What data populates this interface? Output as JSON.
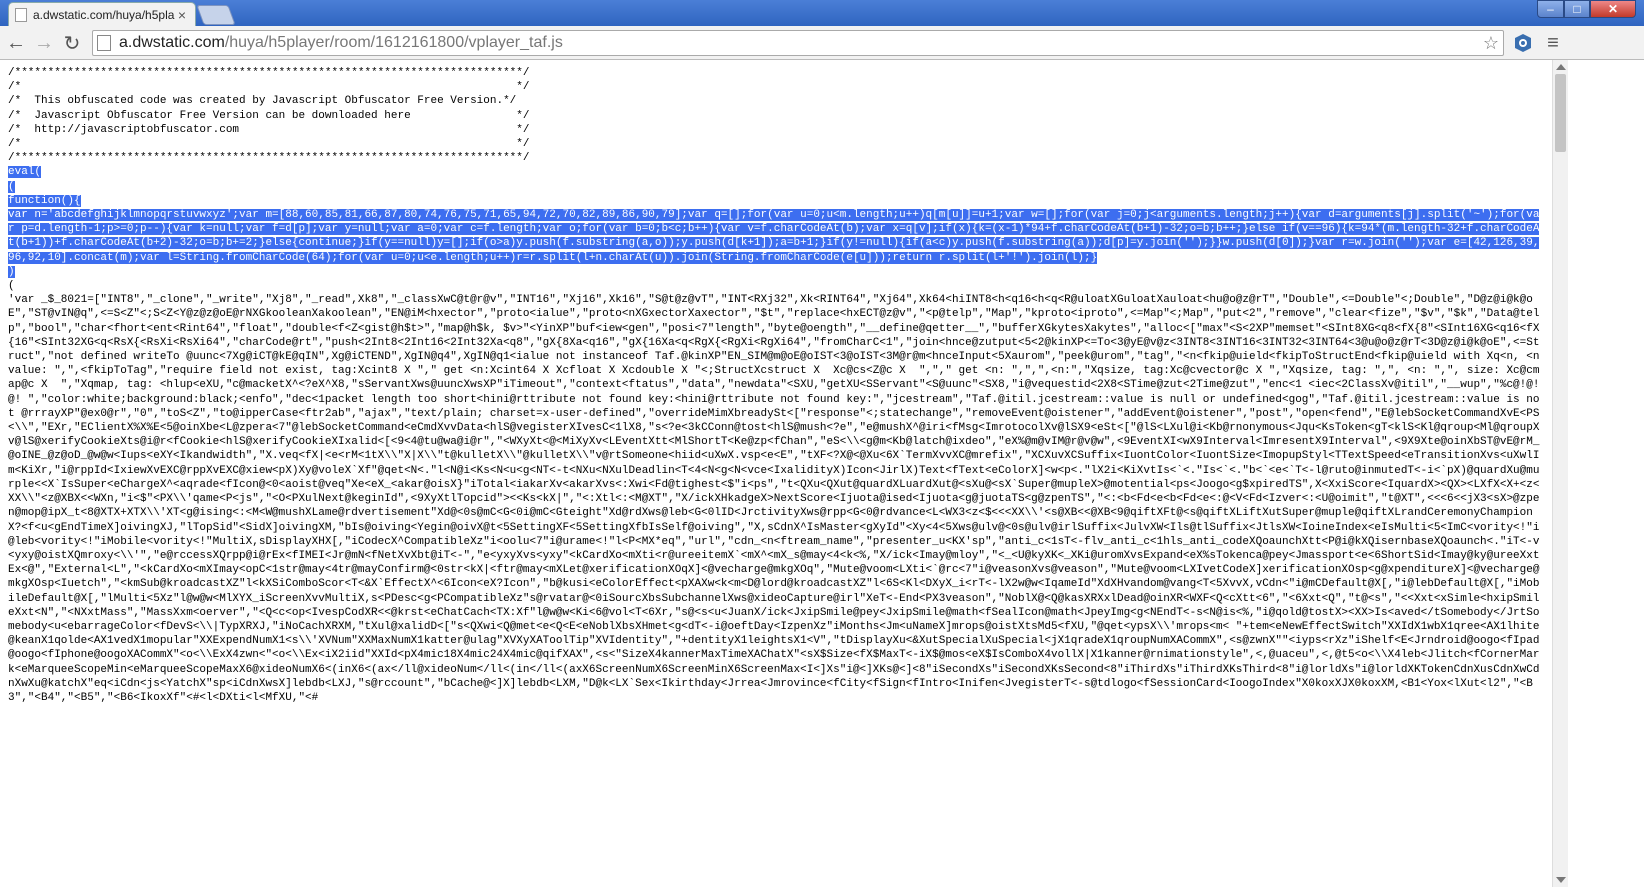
{
  "tab": {
    "title": "a.dwstatic.com/huya/h5pla",
    "close": "×"
  },
  "window": {
    "minimize": "–",
    "maximize": "□",
    "close": "✕"
  },
  "toolbar": {
    "back": "←",
    "forward": "→",
    "reload": "↻",
    "url_host": "a.dwstatic.com",
    "url_path": "/huya/h5player/room/1612161800/vplayer_taf.js",
    "bookmark": "☆",
    "menu": "≡"
  },
  "code": {
    "header": "/*****************************************************************************/\n/*                                                                           */\n/*  This obfuscated code was created by Javascript Obfuscator Free Version.*/\n/*  Javascript Obfuscator Free Version can be downloaded here                */\n/*  http://javascriptobfuscator.com                                          */\n/*                                                                           */\n/*****************************************************************************/\n",
    "selected": "eval(\n(\nfunction(){\nvar n='abcdefghijklmnopqrstuvwxyz';var m=[88,60,85,81,66,87,80,74,76,75,71,65,94,72,70,82,89,86,90,79];var q=[];for(var u=0;u<m.length;u++)q[m[u]]=u+1;var w=[];for(var j=0;j<arguments.length;j++){var d=arguments[j].split('~');for(var p=d.length-1;p>=0;p--){var k=null;var f=d[p];var y=null;var a=0;var c=f.length;var o;for(var b=0;b<c;b++){var v=f.charCodeAt(b);var x=q[v];if(x){k=(x-1)*94+f.charCodeAt(b+1)-32;o=b;b++;}else if(v==96){k=94*(m.length-32+f.charCodeAt(b+1))+f.charCodeAt(b+2)-32;o=b;b+=2;}else{continue;}if(y==null)y=[];if(o>a)y.push(f.substring(a,o));y.push(d[k+1]);a=b+1;}if(y!=null){if(a<c)y.push(f.substring(a));d[p]=y.join('');}}w.push(d[0]);}var r=w.join('');var e=[42,126,39,96,92,10].concat(m);var l=String.fromCharCode(64);for(var u=0;u<e.length;u++)r=r.split(l+n.charAt(u)).join(String.fromCharCode(e[u]));return r.split(l+'!').join(l);}\n)",
    "body": "\n(\n'var _$_8021=[\"INT8\",\"_clone\",\"_write\",\"Xj8\",\"_read\",Xk8\",\"_classXwC@t@r@v\",\"INT16\",\"Xj16\",Xk16\",\"S@t@z@vT\",\"INT<RXj32\",Xk<RINT64\",\"Xj64\",Xk64<hiINT8<h<q16<h<q<R@uloatXGuloatXauloat<hu@o@z@rT\",\"Double\",<=Double\"<;Double\",\"D@z@i@k@oE\",\"ST@vIN@q\",<=S<Z\"<;S<Z<Y@z@z@oE@rNXGkooleanXakoolean\",\"EN@iM<hxector\",\"proto<ialue\",\"proto<nXGxectorXaxector\",\"$t\",\"replace<hxECT@z@v\",\"<p@telp\",\"Map\",\"kproto<iproto\",<=Map\"<;Map\",\"put<2\",\"remove\",\"clear<fize\",\"$v\",\"$k\",\"Data@telp\",\"bool\",\"char<fhort<ent<Rint64\",\"float\",\"double<f<Z<gist@h$t>\",\"map@h$k, $v>\"<YinXP\"buf<iew<gen\",\"posi<7\"length\",\"byte@oength\",\"__define@qetter__\",\"bufferXGkytesXakytes\",\"alloc<[\"max\"<S<2XP\"memset\"<SInt8XG<q8<fX{8\"<SInt16XG<q16<fX{16\"<SInt32XG<q<RsX{<RsXi<RsXi64\",\"charCode@rt\",\"push<2Int8<2Int16<2Int32Xa<q8\",\"gX{8Xa<q16\",\"gX{16Xa<q<RgX{<RgXi<RgXi64\",\"fromCharC<1\",\"join<hnce@zutput<5<2@kinXP<=To<3@yE@v@z<3INT8<3INT16<3INT32<3INT64<3@u@o@z@rT<3D@z@i@k@oE\",<=Struct\",\"not defined writeTo @uunc<7Xg@iCT@kE@qIN\",Xg@iCTEND\",XgIN@q4\",XgIN@q1<ialue not instanceof Taf.@kinXP\"EN_SIM@m@oE@oIST<3@oIST<3M@r@m<hnceInput<5Xaurom\",\"peek@urom\",\"tag\",\"<n<fkip@uield<fkipToStructEnd<fkip@uield with Xq<n, <n value: \",\",<fkipToTag\",\"require field not exist, tag:Xcint8 X \",\" get <n:Xcint64 X Xcfloat X Xcdouble X \"<;StructXcstruct X  Xc@cs<Z@c X  \",\",\" get <n: \",\",\",<n:\",\"Xqsize, tag:Xc@cvector@c X \",\"Xqsize, tag: \",\", <n: \",\", size: Xc@cmap@c X  \",\"Xqmap, tag: <hlup<eXU,\"c@macketX^<?eX^X8,\"sServantXws@uuncXwsXP\"iTimeout\",\"context<ftatus\",\"data\",\"newdata\"<SXU,\"getXU<SServant\"<S@uunc\"<SX8,\"i@vequestid<2X8<STime@zut<2Time@zut\",\"enc<1 <iec<2ClassXv@itil\",\"__wup\",\"%c@!@!@! \",\"color:white;background:black;<enfo\",\"dec<1packet length too short<hini@rttribute not found key:<hini@rttribute not found key:\",\"jcestream\",\"Taf.@itil.jcestream::value is null or undefined<gog\",\"Taf.@itil.jcestream::value is not @rrrayXP\"@ex0@r\",\"0\",\"toS<Z\",\"to@ipperCase<ftr2ab\",\"ajax\",\"text/plain; charset=x-user-defined\",\"overrideMimXbreadySt<[\"response\"<;statechange\",\"removeEvent@oistener\",\"addEvent@oistener\",\"post\",\"open<fend\",\"E@lebSocketCommandXvE<PS<\\\\\",\"EXr,\"EClientX%X%E<5@oinXbe<L@zpera<7\"@lebSocketCommand<eCmdXvvData<hlS@vegisterXIvesC<1lX8,\"s<?e<3kCConn@tost<hlS@mush<?e\",\"e@mushX^@iri<fMsg<ImrotocolXv@lSX9<eSt<[\"@lS<LXul@i<Kb@rnonymous<Jqu<KsToken<gT<klS<Kl@qroup<Ml@qroupXv@lS@xerifyCookieXts@i@r<fCookie<hlS@xerifyCookieXIxalid<[<9<4@tu@wa@i@r\",\"<WXyXt<@<MiXyXv<LEventXtt<MlShortT<Ke@zp<fChan\",\"eS<\\\\<g@m<Kb@latch@ixdeo\",\"eX%@m@vIM@r@v@w\",<9EventXI<wX9Interval<ImresentX9Interval\",<9X9Xte@oinXbST@vE@rM_@oINE_@z@oD_@w@w<Iups<eXY<Ikandwidth\",\"X.veq<fX|<e<rM<1tX\\\\\"X|X\\\\\"t@kulletX\\\\\"@kulletX\\\\\"v@rtSomeone<hiid<uXwX.vsp<e<E\",\"tXF<?X@<@Xu<6X`TermXvvXC@mrefix\",\"XCXuvXCSuffix<IuontColor<IuontSize<ImopupStyl<TTextSpeed<eTransitionXvs<uXwlIm<KiXr,\"i@rppId<IxiewXvEXC@rppXvEXC@xiew<pX)Xy@voleX`Xf\"@qet<N<.\"l<N@i<Ks<N<u<g<NT<-t<NXu<NXulDeadlin<T<4<N<g<N<vce<IxalidityX)Icon<JirlX)Text<fText<eColorX]<w<p<.\"lX2i<KiXvtIs<`<.\"Is<`<.\"b<`<e<`T<-l@ruto@inmutedT<-i<`pX)@quardXu@murple<<X`IsSuper<eChargeX^<aqrade<fIcon@<0<aoist@veq\"Xe<eX_<akar@oisX}\"iTotal<iakarXv<akarXvs<:Xwi<Fd@tighest<$\"i<ps\",\"t<QXu<QXut@quardXLuardXut@<sXu@<sX`Super@mupleX>@motential<ps<Joogo<g$xpiredTS\",X<XxiScore<IquardX><QX><LXfX<X+<z<XX\\\\\"<z@XBX<<WXn,\"i<$\"<PX\\\\'qame<P<js\",\"<O<PXulNext@keginId\",<9XyXtlTopcid\"><<Ks<kX|\",\"<:Xtl<:<M@XT\",\"X/ickXHkadgeX>NextScore<Ijuota@ised<Ijuota<g@juotaTS<g@zpenTS\",\"<:<b<Fd<e<b<Fd<e<:@<V<Fd<Izver<:<U@oimit\",\"t@XT\",<<<6<<jX3<sX>@zpen@mop@ipX_t<8@XTX+XTX\\\\'XT<g@ising<:<M<W@mushXLame@rdvertisement\"Xd@<0s@mC<G<0i@mC<Gteight\"Xd@rdXws@leb<G<0lID<JrctivityXws@rpp<G<0@rdvance<L<WX3<z<$<<<XX\\\\'<s@XB<<@XB<9@qiftXFt@<s@qiftXLiftXutSuper@muple@qiftXLrandCeremonyChampionX?<f<u<gEndTimeX]oivingXJ,\"lTopSid\"<SidX]oivingXM,\"bIs@oiving<Yegin@oivX@t<5SettingXF<5SettingXfbIsSelf@oiving\",\"X,sCdnX^IsMaster<gXyId\"<Xy<4<5Xws@ulv@<0s@ulv@irlSuffix<JulvXW<Ils@tlSuffix<JtlsXW<IoineIndex<eIsMulti<5<ImC<vority<!\"i@leb<vority<!\"iMobile<vority<!\"MultiX,sDisplayXHX[,\"iCodecX^CompatibleXz\"i<oolu<7\"i@urame<!\"l<P<MX*eq\",\"url\",\"cdn_<n<ftream_name\",\"presenter_u<KX'sp\",\"anti_c<1sT<-flv_anti_c<1hls_anti_codeXQoaunchXtt<P@i@kXQisernbaseXQoaunch<.\"iT<-v<yxy@oistXQmroxy<\\\\'\",\"e@rccessXQrpp@i@rEx<fIMEI<Jr@mN<fNetXvXbt@iT<-\",\"e<yxyXvs<yxy\"<kCardXo<mXti<r@ureeitemX`<mX^<mX_s@may<4<k<%,\"X/ick<Imay@mloy\",\"<_<U@kyXK<_XKi@uromXvsExpand<eX%sTokenca@pey<Jmassport<e<6ShortSid<Imay@ky@ureeXxtEx<@\",\"External<L\",\"<kCardXo<mXImay<opC<1str@may<4tr@mayConfirm@<0str<kX|<ftr@may<mXLet@xerificationXOqX]<@vecharge@mkgXOq\",\"Mute@voom<LXti<`@rc<7\"i@veasonXvs@veason\",\"Mute@voom<LXIvetCodeX]xerificationXOsp<g@xpenditureX]<@vecharge@mkgXOsp<Iuetch\",\"<kmSub@kroadcastXZ\"l<kXSiComboScor<T<&X`EffectX^<6Icon<eX?Icon\",\"b@kusi<eColorEffect<pXAXw<k<m<D@lord@kroadcastXZ\"l<6S<Kl<DXyX_i<rT<-lX2w@w<IqameId\"XdXHvandom@vang<T<5XvvX,vCdn<\"i@mCDefault@X[,\"i@lebDefault@X[,\"iMobileDefault@X[,\"lMulti<5Xz\"l@w@w<MlXYX_iScreenXvvMultiX,s<PDesc<g<PCompatibleXz\"s@rvatar@<0iSourcXbsSubchannelXws@xideoCapture@irl\"XeT<-End<PX3veason\",\"NoblX@<Q@kasXRXxlDead@oinXR<WXF<Q<cXtt<6\",\"<6Xxt<Q\",\"t@<s\",\"<<Xxt<xSimle<hxipSmileXxt<N\",\"<NXxtMass\",\"MassXxm<oerver\",\"<Q<c<op<IvespCodXR<<@krst<eChatCach<TX:Xf\"l@w@w<Ki<6@vol<T<6Xr,\"s@<s<u<JuanX/ick<JxipSmile@pey<JxipSmile@math<fSealIcon@math<JpeyImg<g<NEndT<-s<N@is<%,\"i@qold@tostX><XX>Is<aved</tSomebody</JrtSomebody<u<ebarrageColor<fDevS<\\\\|TypXRXJ,\"iNoCachXRXM,\"tXul@xalidD<[\"s<QXwi<Q@met<e<Q<E<eNoblXbsXHmet<g<dT<-i@oeftDay<IzpenXz\"iMonths<Jm<uNameX]mrops@oistXtsMd5<fXU,\"@qet<ypsX\\\\'mrops<m< \"+tem<eNewEffectSwitch\"XXIdX1wbX1qree<AX1lhite@keanX1qolde<AX1vedX1mopular\"XXExpendNumX1<s\\\\'XVNum\"XXMaxNumX1katter@ulag\"XVXyXAToolTip\"XVIdentity\",\"+dentityX1leightsX1<V\",\"tDisplayXu<&XutSpecialXuSpecial<jX1qradeX1qroupNumXACommX\",<s@zwnX\"\"<iyps<rXz\"iShelf<E<Jrndroid@oogo<fIpad@oogo<fIphone@oogoXACommX\"<o<\\\\ExX4zwn<\"<o<\\\\Ex<iX2iid\"XXId<pX4mic18X4mic24X4mic@qifXAX\",<s<\"SizeX4kannerMaxTimeXAChatX\"<sX$Size<fX$MaxT<-iX$@mos<eX$IsComboX4vollX|X1kanner@rnimationstyle\",<,@uaceu\",<,@t5<o<\\\\X4leb<Jlitch<fCornerMark<eMarqueeScopeMin<eMarqueeScopeMaxX6@xideoNumX6<(inX6<(ax</ll@xideoNum</ll<(in</ll<(axX6ScreenNumX6ScreenMinX6ScreenMax<I<]Xs\"i@<]XKs@<]<8\"iSecondXs\"iSecondXKsSecond<8\"iThirdXs\"iThirdXKsThird<8\"i@lorldXs\"i@lorldXKTokenCdnXusCdnXwCdnXwXu@katchX\"eq<iCdn<js<YatchX\"sp<iCdnXwsX]lebdb<LXJ,\"s@rccount\",\"bCache@<]X]lebdb<LXM,\"D@k<LX`Sex<Ikirthday<Jrrea<Jmrovince<fCity<fSign<fIntro<Inifen<JvegisterT<-s@tdlogo<fSessionCard<IoogoIndex\"X0koxXJX0koxXM,<B1<Yox<lXut<l2\",\"<B3\",\"<B4\",\"<B5\",\"<B6<IkoxXf\"<#<l<DXti<l<MfXU,\"<#"
  }
}
